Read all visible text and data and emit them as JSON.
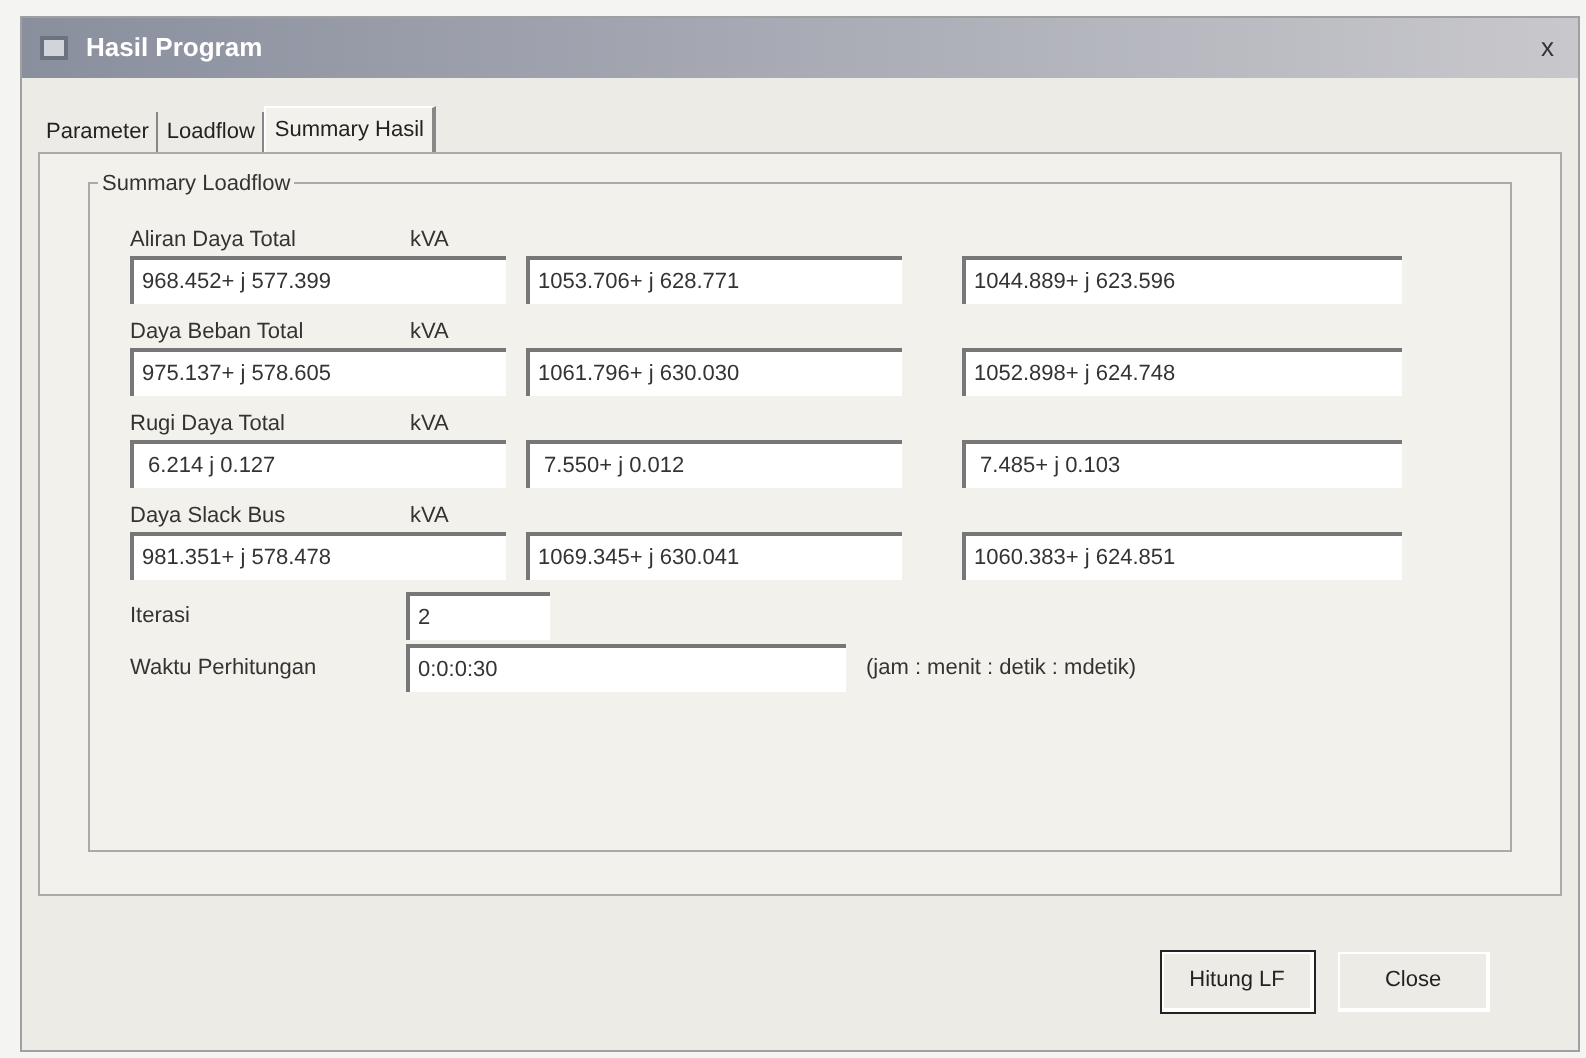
{
  "window": {
    "title": "Hasil Program",
    "close": "x"
  },
  "tabs": [
    {
      "label": "Parameter",
      "selected": false
    },
    {
      "label": "Loadflow",
      "selected": false
    },
    {
      "label": "Summary Hasil",
      "selected": true
    }
  ],
  "group": {
    "title": "Summary Loadflow",
    "rows": [
      {
        "label": "Aliran Daya Total",
        "unit": "kVA",
        "values": [
          "968.452+ j 577.399",
          "1053.706+ j 628.771",
          "1044.889+ j 623.596"
        ]
      },
      {
        "label": "Daya Beban Total",
        "unit": "kVA",
        "values": [
          "975.137+ j 578.605",
          "1061.796+ j 630.030",
          "1052.898+ j 624.748"
        ]
      },
      {
        "label": "Rugi Daya Total",
        "unit": "kVA",
        "values": [
          " 6.214 j 0.127",
          " 7.550+ j 0.012",
          " 7.485+ j 0.103"
        ]
      },
      {
        "label": "Daya Slack Bus",
        "unit": "kVA",
        "values": [
          "981.351+ j 578.478",
          "1069.345+ j 630.041",
          "1060.383+ j 624.851"
        ]
      }
    ],
    "iterasi": {
      "label": "Iterasi",
      "value": "2"
    },
    "waktu": {
      "label": "Waktu Perhitungan",
      "value": "0:0:0:30",
      "hint": "(jam : menit : detik : mdetik)"
    }
  },
  "buttons": [
    {
      "label": "Hitung LF",
      "default": true
    },
    {
      "label": "Close",
      "default": false
    }
  ]
}
